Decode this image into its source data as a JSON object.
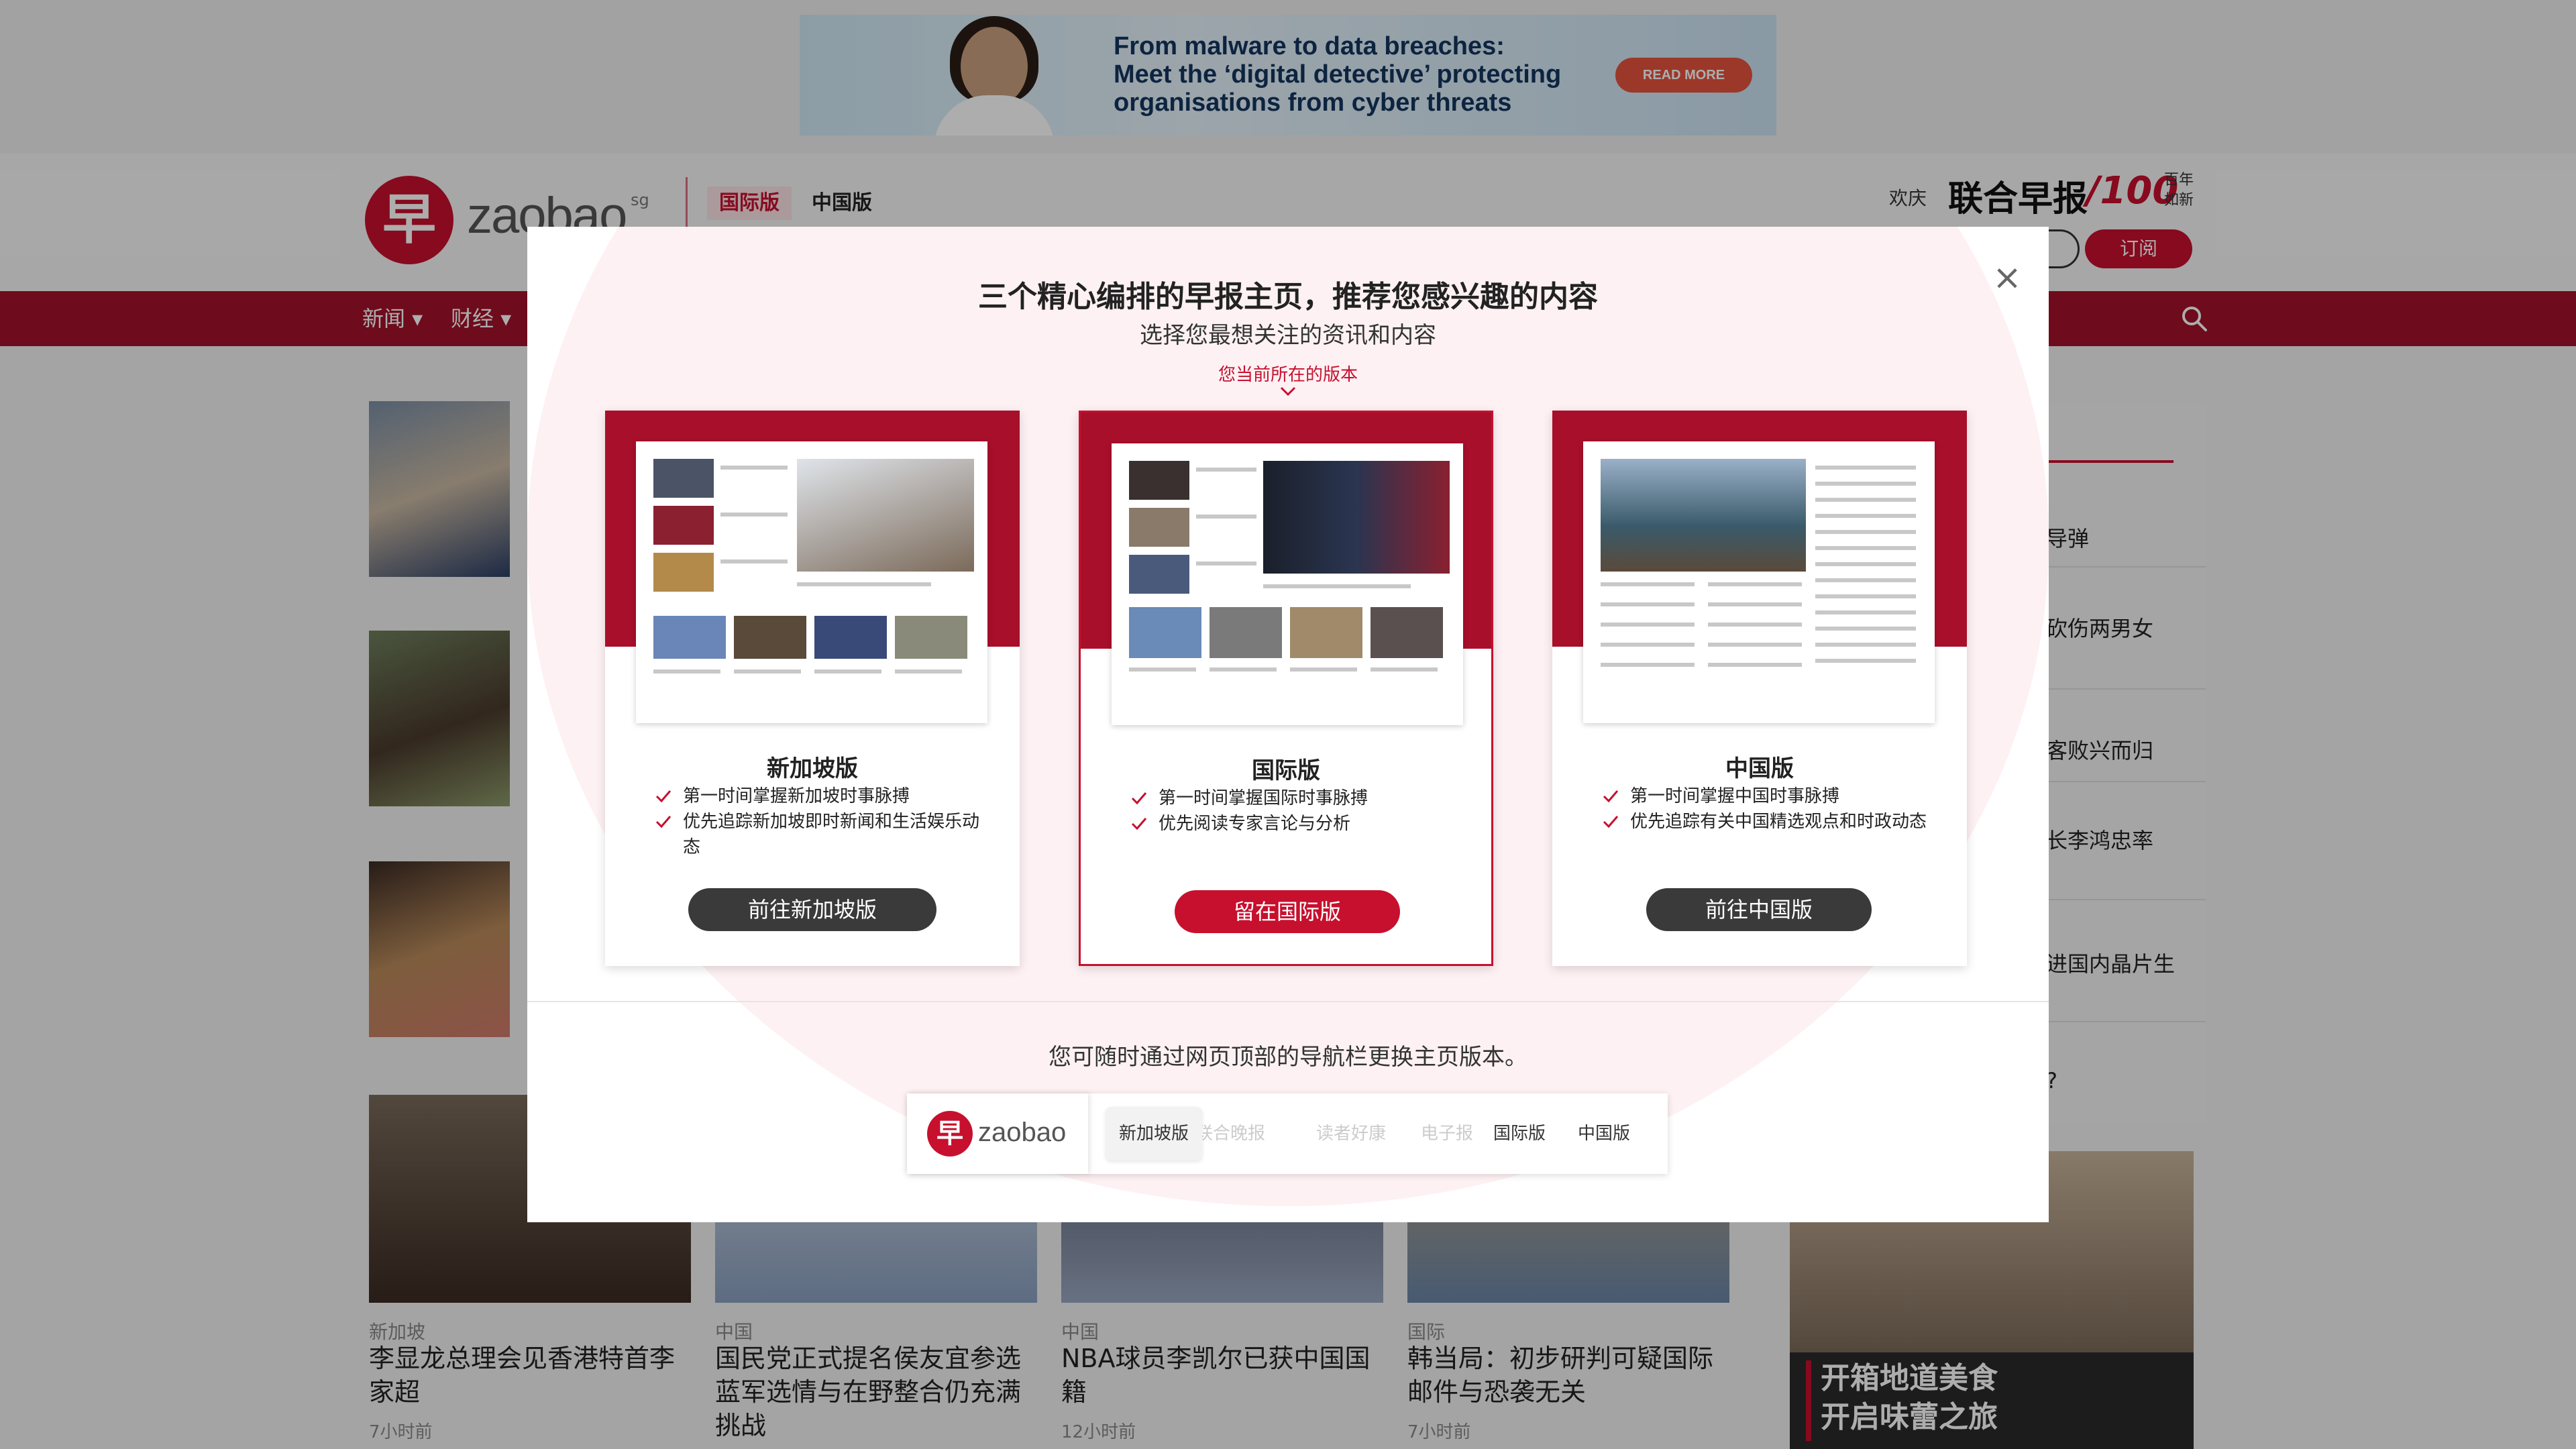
{
  "ad": {
    "headline_line1": "From malware to data breaches:",
    "headline_line2": "Meet the ‘digital detective’ protecting",
    "headline_line3": "organisations from cyber threats",
    "cta": "READ MORE"
  },
  "header": {
    "logo_word": "zaobao",
    "logo_suffix": "sg",
    "edition_tabs": [
      "国际版",
      "中国版"
    ],
    "active_tab": "国际版",
    "celebrate": "欢庆",
    "brand": "联合早报",
    "brand_100": "/100",
    "brand_100_sub_line1": "百年",
    "brand_100_sub_line2": "如新",
    "subscribe": "订阅"
  },
  "nav": {
    "items": [
      "新闻 ▾",
      "财经 ▾"
    ]
  },
  "stories": [
    {
      "category": "新加坡",
      "title": "李显龙总理会见香港特首李家超",
      "time": "7小时前"
    },
    {
      "category": "中国",
      "title": "国民党正式提名侯友宜参选 蓝军选情与在野整合仍充满挑战",
      "time": ""
    },
    {
      "category": "中国",
      "title": "NBA球员李凯尔已获中国国籍",
      "time": "12小时前"
    },
    {
      "category": "国际",
      "title": "韩当局：初步研判可疑国际邮件与恐袭无关",
      "time": "7小时前"
    }
  ],
  "sidebar": {
    "items": [
      "导弹",
      "砍伤两男女",
      "客败兴而归",
      "长李鸿忠率",
      "进国内晶片生",
      "?"
    ]
  },
  "promo": {
    "line1": "开箱地道美食",
    "line2": "开启味蕾之旅"
  },
  "modal": {
    "title": "三个精心编排的早报主页，推荐您感兴趣的内容",
    "subtitle": "选择您最想关注的资讯和内容",
    "current_label": "您当前所在的版本",
    "close_label": "×",
    "cards": [
      {
        "title": "新加坡版",
        "features": [
          "第一时间掌握新加坡时事脉搏",
          "优先追踪新加坡即时新闻和生活娱乐动态"
        ],
        "button": "前往新加坡版",
        "current": false
      },
      {
        "title": "国际版",
        "features": [
          "第一时间掌握国际时事脉搏",
          "优先阅读专家言论与分析"
        ],
        "button": "留在国际版",
        "current": true
      },
      {
        "title": "中国版",
        "features": [
          "第一时间掌握中国时事脉搏",
          "优先追踪有关中国精选观点和时政动态"
        ],
        "button": "前往中国版",
        "current": false
      }
    ],
    "footer_note": "您可随时通过网页顶部的导航栏更换主页版本。",
    "nav_demo": {
      "logo_word": "zaobao",
      "items": [
        "新加坡版",
        "联合晚报",
        "读者好康",
        "电子报",
        "国际版",
        "中国版"
      ]
    }
  },
  "colors": {
    "brand_red": "#c7102e",
    "nav_red": "#a3112a",
    "dark_button": "#3a3a3a"
  }
}
